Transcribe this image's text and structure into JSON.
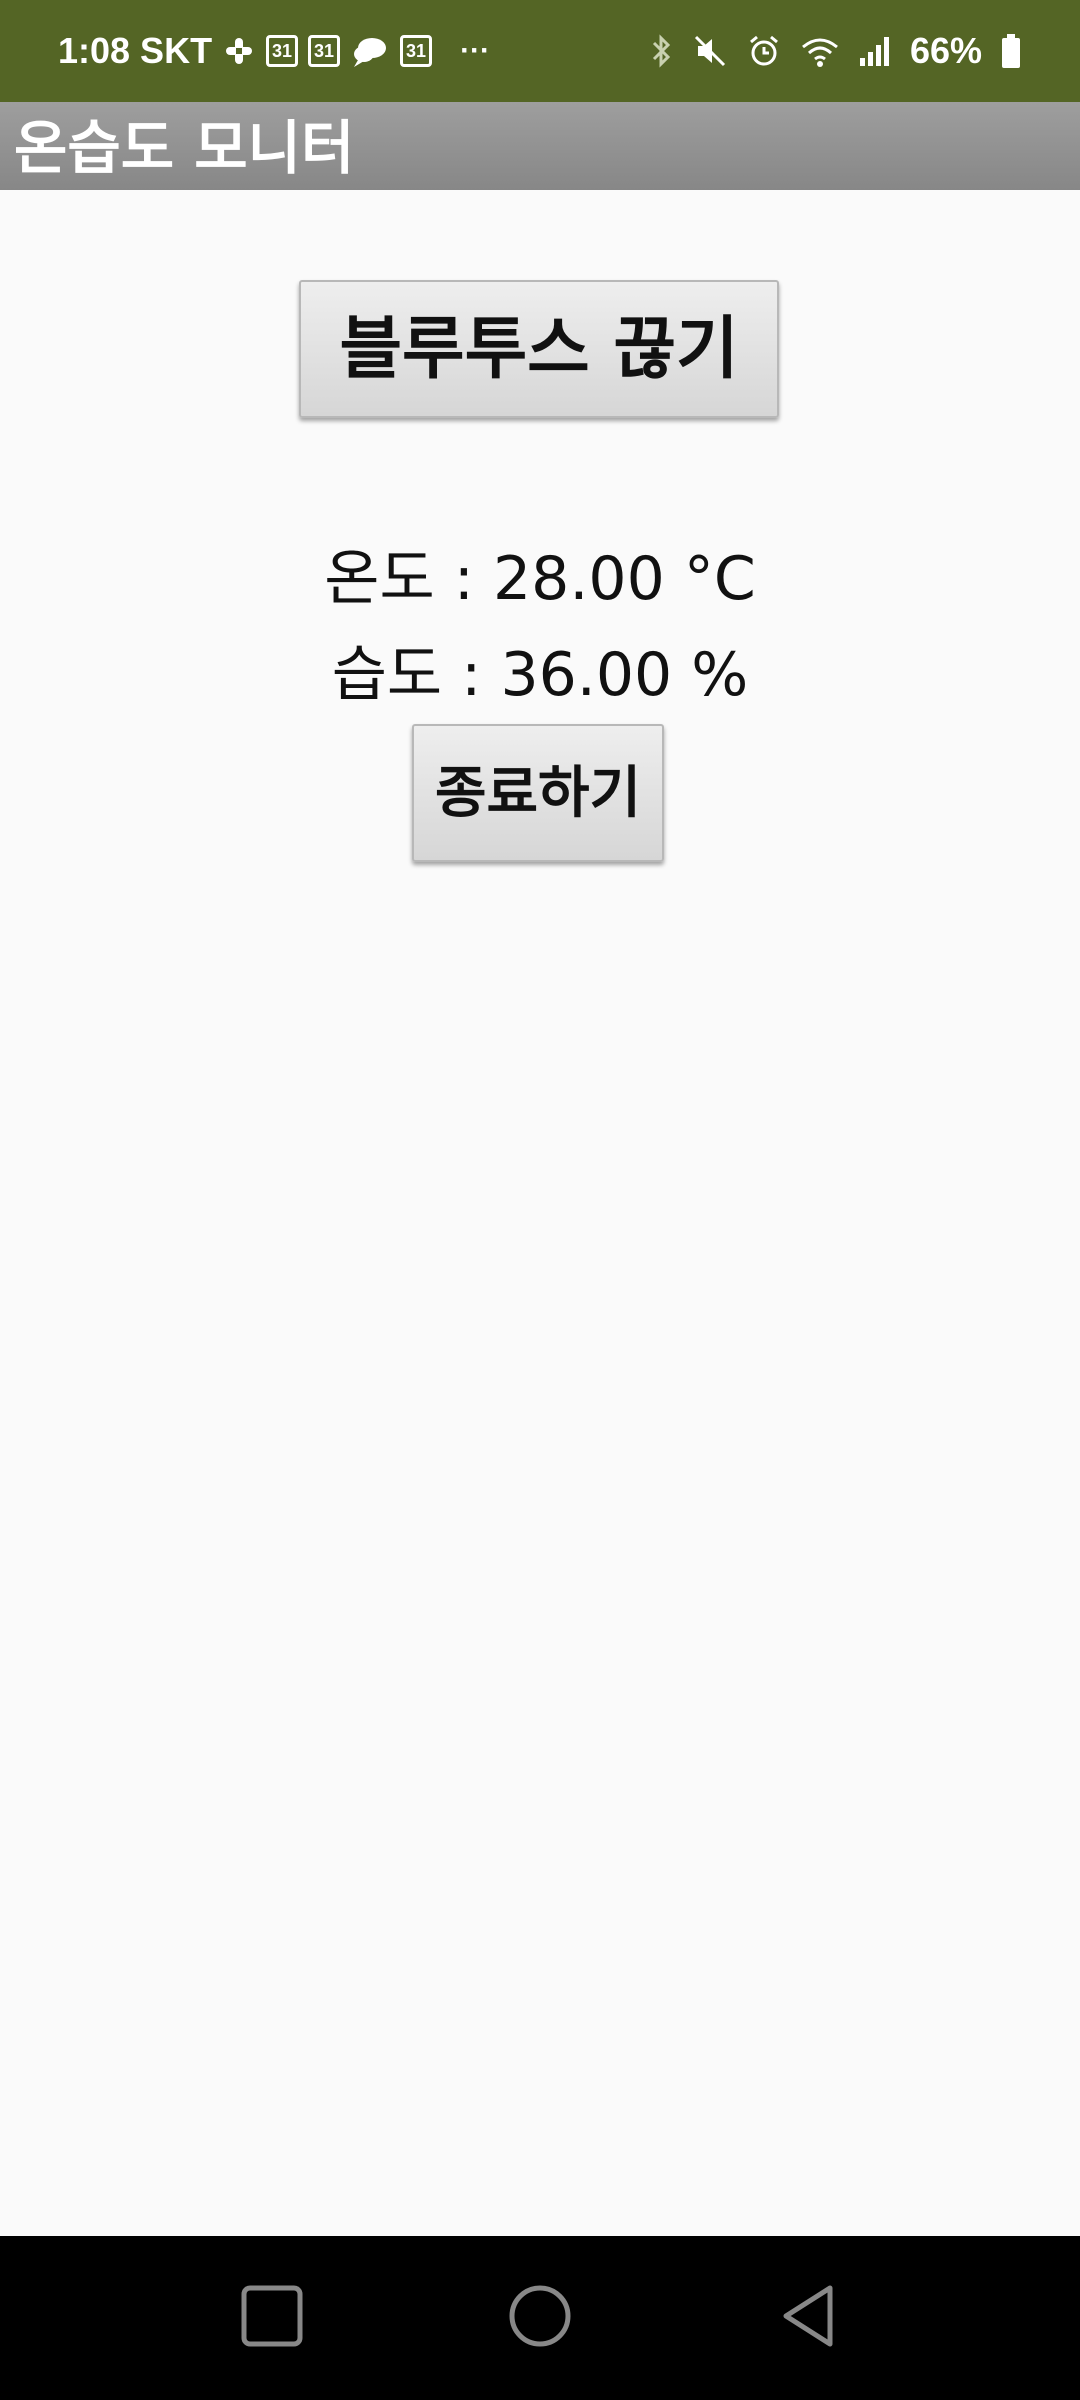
{
  "status_bar": {
    "time_carrier": "1:08 SKT",
    "calendar_day": "31",
    "more": "···",
    "battery": "66%"
  },
  "app": {
    "title": "온습도 모니터"
  },
  "main": {
    "bluetooth_button": "블루투스 끊기",
    "temperature_line": "온도 : 28.00 °C",
    "humidity_line": "습도 : 36.00 %",
    "exit_button": "종료하기"
  },
  "colors": {
    "status_bar": "#546525",
    "title_bar": "#8f8f8f",
    "background": "#fafafa",
    "nav_bar": "#000000"
  },
  "icons": {
    "status_left": [
      "slack-icon",
      "calendar-icon",
      "calendar-icon",
      "cloud-icon",
      "calendar-icon"
    ],
    "status_right": [
      "bluetooth-icon",
      "mute-icon",
      "alarm-icon",
      "wifi-icon",
      "signal-icon",
      "battery-icon"
    ],
    "nav": [
      "recents-icon",
      "home-icon",
      "back-icon"
    ]
  }
}
